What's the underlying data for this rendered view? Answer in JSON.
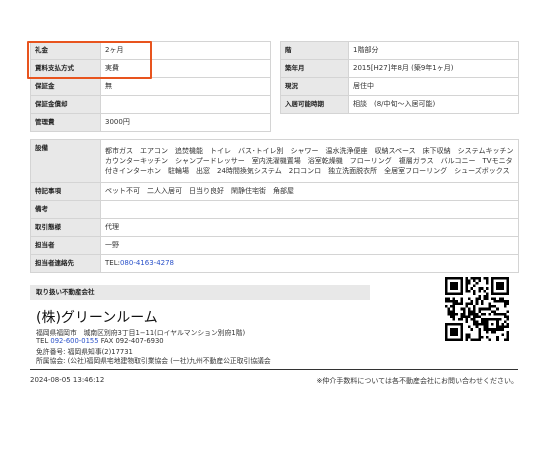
{
  "top_left": [
    {
      "key": "礼金",
      "value": "2ヶ月"
    },
    {
      "key": "賃料支払方式",
      "value": "実費"
    },
    {
      "key": "保証金",
      "value": "無"
    },
    {
      "key": "保証金償却",
      "value": ""
    },
    {
      "key": "管理費",
      "value": "3000円"
    }
  ],
  "top_right": [
    {
      "key": "階",
      "value": "1階部分"
    },
    {
      "key": "築年月",
      "value": "2015[H27]年8月 (築9年1ヶ月)"
    },
    {
      "key": "現況",
      "value": "居住中"
    },
    {
      "key": "入居可能時期",
      "value": "相談　(8/中旬〜入居可能)"
    }
  ],
  "details": {
    "equipment_key": "設備",
    "equipment_value": "都市ガス　エアコン　追焚機能　トイレ　バス･トイレ別　シャワー　温水洗浄便座　収納スペース　床下収納　システムキッチン　カウンターキッチン　シャンプードレッサー　室内洗濯機置場　浴室乾燥機　フローリング　複層ガラス　バルコニー　TVモニタ付きインターホン　駐輪場　出窓　24時間換気システム　2口コンロ　独立洗面脱衣所　全居室フローリング　シューズボックス",
    "features_key": "特記事項",
    "features_value": "ペット不可　二人入居可　日当り良好　閑静住宅街　角部屋",
    "remarks_key": "備考",
    "remarks_value": "",
    "transaction_key": "取引態様",
    "transaction_value": "代理",
    "contact_person_key": "担当者",
    "contact_person_value": "一野",
    "contact_key": "担当者連絡先",
    "contact_prefix": "TEL:",
    "contact_phone": "080-4163-4278"
  },
  "agency": {
    "header": "取り扱い不動産会社",
    "name": "(株)グリーンルーム",
    "address": "福岡県福岡市　城南区別府3丁目1−11(ロイヤルマンション別府1階)",
    "tel_label": "TEL",
    "tel": "092-600-0155",
    "fax": "FAX 092-407-6930",
    "license": "免許番号: 福岡県知事(2)17731",
    "association": "所属協会: (公社)福岡県宅地建物取引業協会 (一社)九州不動産公正取引協議会"
  },
  "footer": {
    "timestamp": "2024-08-05 13:46:12",
    "note": "※仲介手数料については各不動産会社にお問い合わせください。"
  },
  "colors": {
    "highlight": "#e8541e",
    "link": "#2b52c9",
    "label_bg": "#e8e8e8"
  }
}
